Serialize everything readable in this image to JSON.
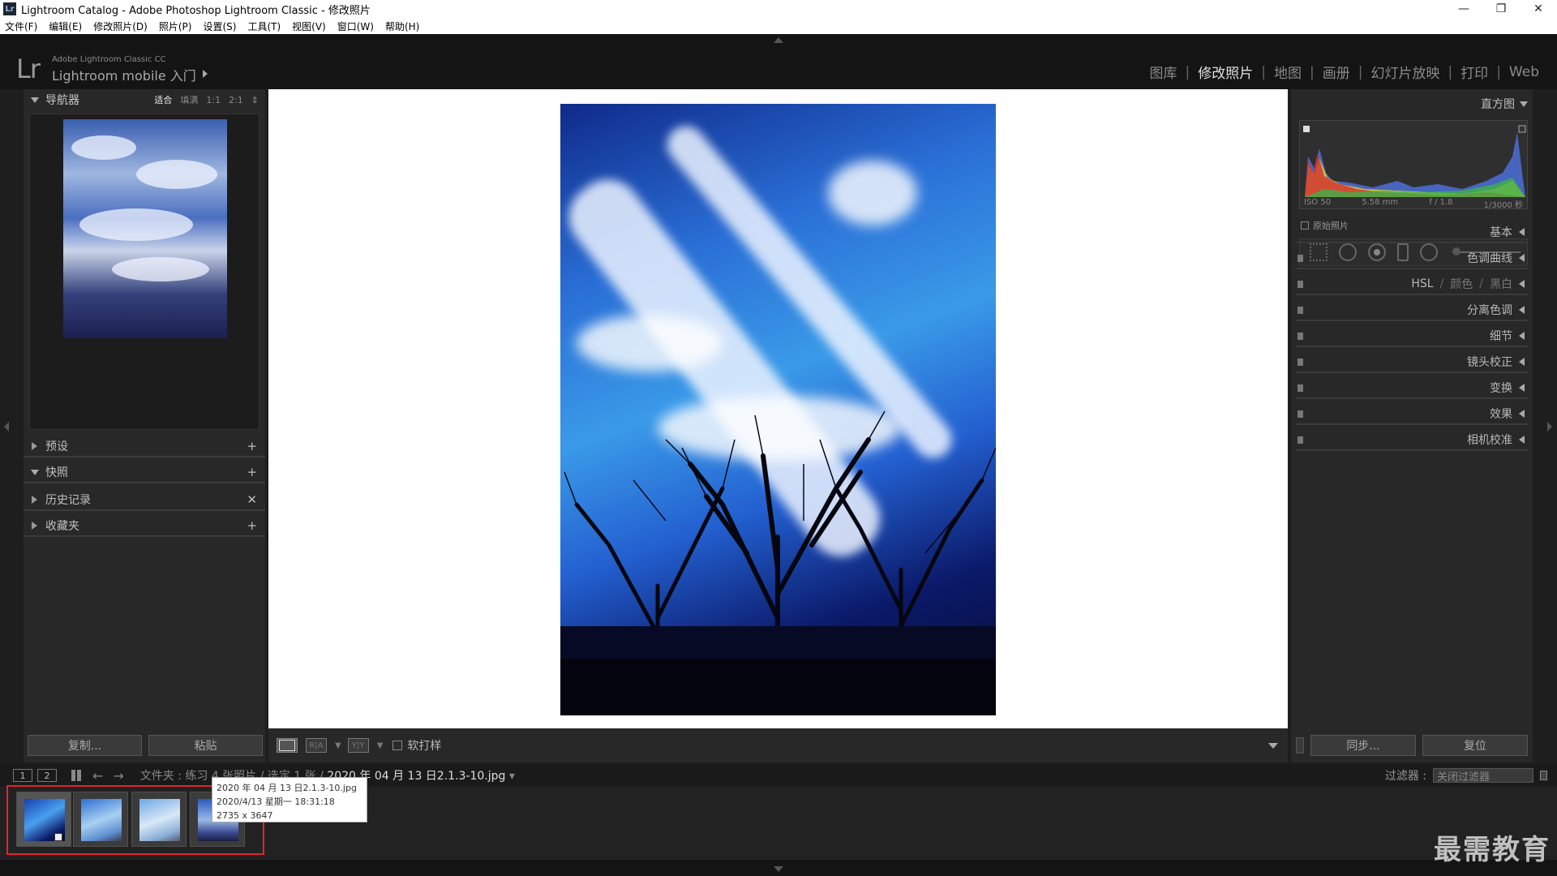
{
  "window": {
    "title": "Lightroom Catalog - Adobe Photoshop Lightroom Classic - 修改照片",
    "app_icon": "Lr",
    "controls": {
      "minimize": "—",
      "restore": "❐",
      "close": "✕"
    }
  },
  "menu": [
    "文件(F)",
    "编辑(E)",
    "修改照片(D)",
    "照片(P)",
    "设置(S)",
    "工具(T)",
    "视图(V)",
    "窗口(W)",
    "帮助(H)"
  ],
  "identity": {
    "logo": "Lr",
    "product": "Adobe Lightroom Classic CC",
    "status": "Lightroom mobile 入门"
  },
  "modules": {
    "items": [
      "图库",
      "修改照片",
      "地图",
      "画册",
      "幻灯片放映",
      "打印",
      "Web"
    ],
    "active": "修改照片",
    "separator": "|"
  },
  "left_panel": {
    "navigator": {
      "title": "导航器",
      "zoom_options": [
        "适合",
        "填满",
        "1:1",
        "2:1"
      ],
      "zoom_active": "适合",
      "zoom_spinner": "⇕"
    },
    "sections": [
      {
        "label": "预设",
        "action": "+",
        "expanded": false
      },
      {
        "label": "快照",
        "action": "+",
        "expanded": true
      },
      {
        "label": "历史记录",
        "action": "✕",
        "expanded": false
      },
      {
        "label": "收藏夹",
        "action": "+",
        "expanded": false
      }
    ],
    "buttons": {
      "copy": "复制...",
      "paste": "粘贴"
    }
  },
  "toolbar": {
    "soft_proof_label": "软打样",
    "before_after_label": "R|A",
    "yy_label": "Y|Y"
  },
  "right_panel": {
    "histogram_title": "直方图",
    "exif": {
      "iso": "ISO 50",
      "focal": "5.58 mm",
      "aperture": "f / 1.8",
      "shutter": "1/3000 秒"
    },
    "original_photo_label": "原始照片",
    "sections": [
      "基本",
      "色调曲线",
      "细节",
      "镜头校正",
      "变换",
      "效果",
      "相机校准"
    ],
    "hsl": {
      "hsl": "HSL",
      "color": "颜色",
      "bw": "黑白",
      "sep": "/"
    },
    "split_toning": "分离色调",
    "buttons": {
      "sync": "同步...",
      "reset": "复位"
    }
  },
  "filmstrip_bar": {
    "screen1": "1",
    "screen2": "2",
    "source_path": "文件夹 : 练习",
    "count": "4 张照片 / 选定 1 张 /",
    "filename": "2020 年 04 月 13 日2.1.3-10.jpg",
    "filter_label": "过滤器 :",
    "filter_value": "关闭过滤器"
  },
  "tooltip": {
    "line1": "2020 年 04 月 13 日2.1.3-10.jpg",
    "line2": "2020/4/13 星期一 18:31:18",
    "line3": "2735 x 3647"
  },
  "watermark": "最需教育",
  "colors": {
    "accent_selection": "#e2242d",
    "panel_bg": "#282828",
    "workspace_bg": "#ffffff"
  }
}
